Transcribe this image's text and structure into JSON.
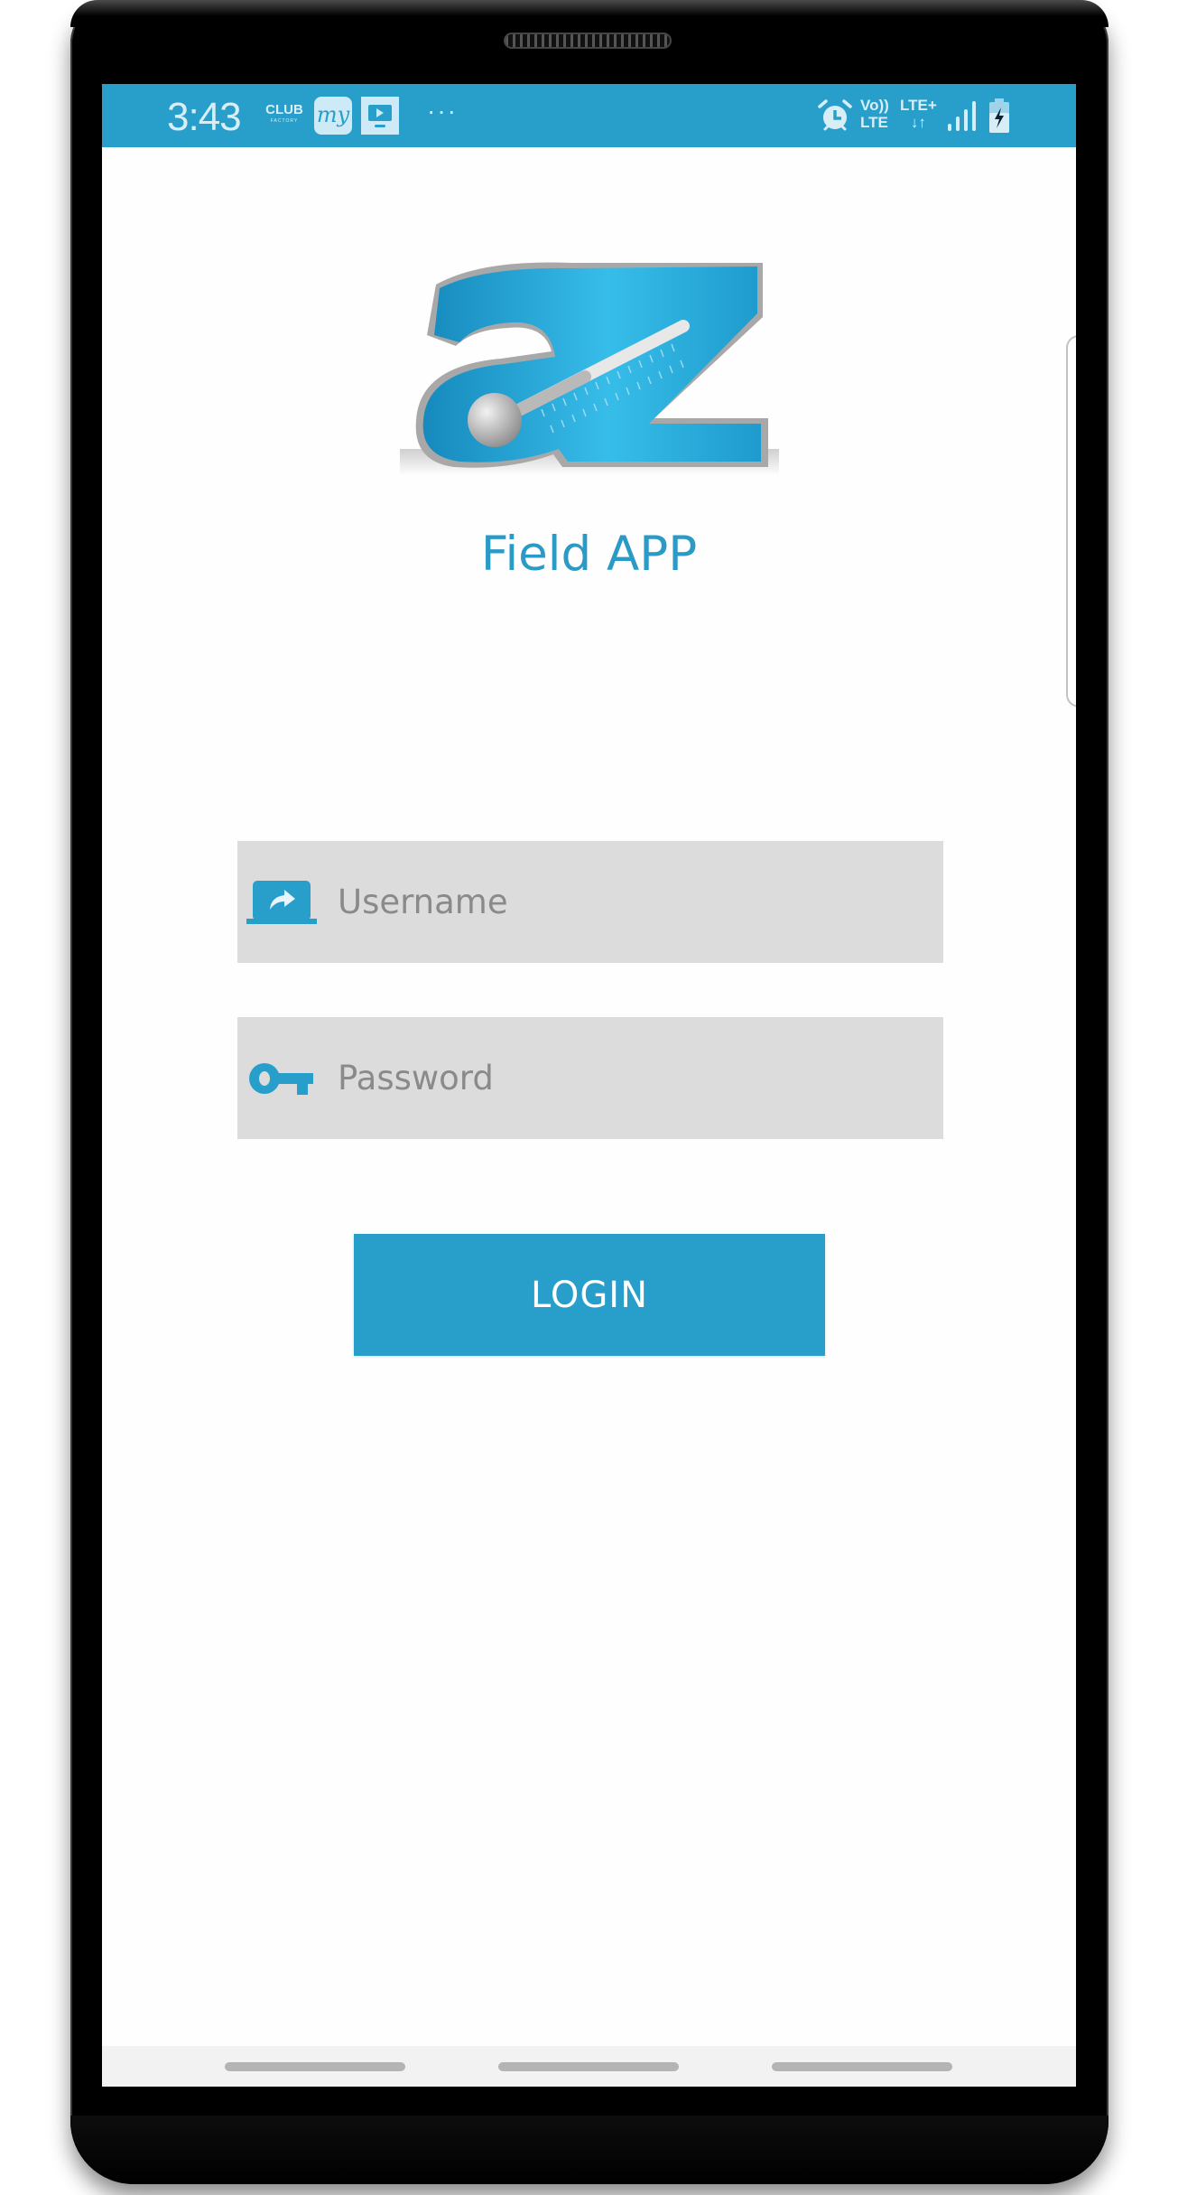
{
  "status_bar": {
    "time": "3:43",
    "notification_icons": [
      "club-factory-icon",
      "makemytrip-my-icon",
      "video-player-icon",
      "more-notifications-icon"
    ],
    "club_label": "CLUB",
    "club_sublabel": "FACTORY",
    "my_label": "my",
    "more": "···",
    "volte_line1": "Vo))",
    "volte_line2": "LTE",
    "lte_line1": "LTE+",
    "lte_line2": "↓↑",
    "system_icons": [
      "alarm-icon",
      "volte-icon",
      "lte-plus-data-icon",
      "signal-icon",
      "battery-charging-icon"
    ]
  },
  "app": {
    "logo_alt": "az logo",
    "title": "Field APP"
  },
  "login_form": {
    "username": {
      "placeholder": "Username",
      "value": "",
      "icon": "laptop-share-icon"
    },
    "password": {
      "placeholder": "Password",
      "value": "",
      "icon": "key-icon"
    },
    "submit_label": "LOGIN"
  },
  "colors": {
    "accent": "#279fca",
    "title": "#2a9ac6",
    "field_bg": "#dcdcdc",
    "placeholder": "#8a8a8a",
    "nav_bar_bg": "#f2f2f2"
  },
  "nav_bar": {
    "buttons": [
      "recents-gesture",
      "home-gesture",
      "back-gesture"
    ]
  }
}
